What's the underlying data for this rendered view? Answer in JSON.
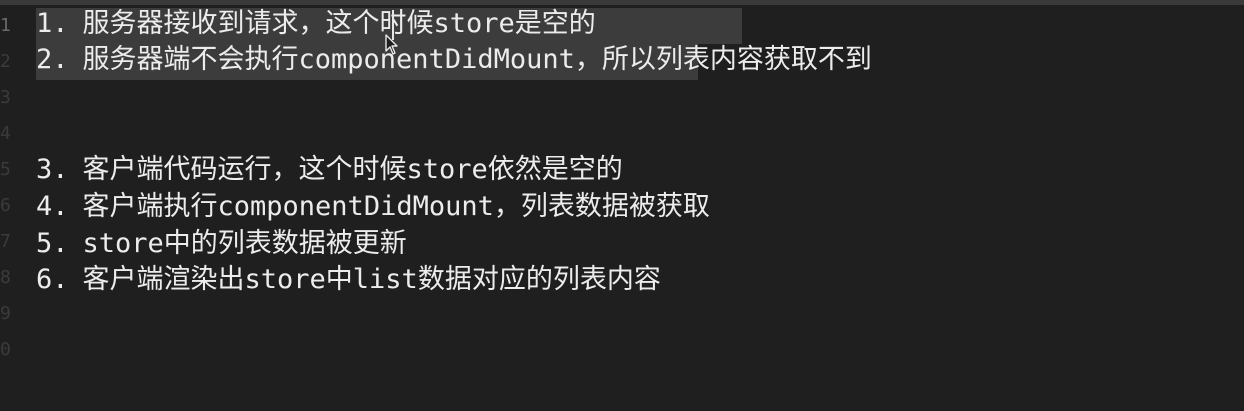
{
  "editor": {
    "line_numbers": [
      "1",
      "2",
      "3",
      "4",
      "5",
      "6",
      "7",
      "8",
      "9",
      "0"
    ],
    "lines": [
      {
        "num": "1.",
        "text": "服务器接收到请求，这个时候store是空的"
      },
      {
        "num": "2.",
        "text": "服务器端不会执行componentDidMount，所以列表内容获取不到"
      },
      {
        "num": "",
        "text": ""
      },
      {
        "num": "",
        "text": ""
      },
      {
        "num": "3.",
        "text": "客户端代码运行，这个时候store依然是空的"
      },
      {
        "num": "4.",
        "text": "客户端执行componentDidMount，列表数据被获取"
      },
      {
        "num": "5.",
        "text": "store中的列表数据被更新"
      },
      {
        "num": "6.",
        "text": "客户端渲染出store中list数据对应的列表内容"
      }
    ]
  },
  "colors": {
    "background": "#1f1f1f",
    "text": "#ececec",
    "selection": "#3c3c3c",
    "line_number": "#3b3b3b"
  },
  "icons": {
    "pointer": "mouse-pointer-icon",
    "caret": "text-caret"
  }
}
